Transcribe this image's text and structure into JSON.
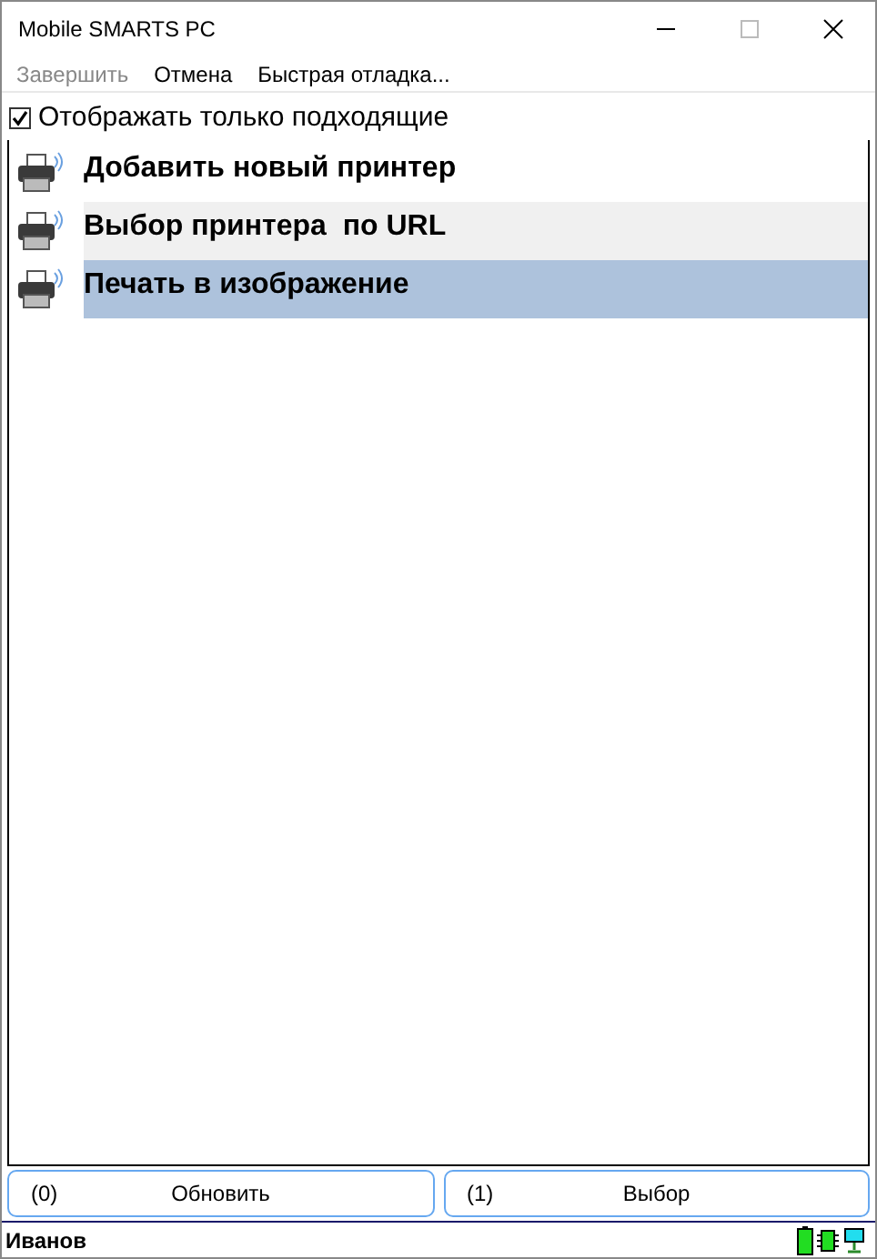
{
  "window": {
    "title": "Mobile SMARTS PC"
  },
  "menu": [
    {
      "label": "Завершить",
      "disabled": true
    },
    {
      "label": "Отмена",
      "disabled": false
    },
    {
      "label": "Быстрая отладка...",
      "disabled": false
    }
  ],
  "filter": {
    "label": "Отображать только подходящие",
    "checked": true
  },
  "items": [
    {
      "label": "Добавить новый принтер",
      "selected": false,
      "hovered": false
    },
    {
      "label": "Выбор принтера  по URL",
      "selected": false,
      "hovered": true
    },
    {
      "label": "Печать в изображение",
      "selected": true,
      "hovered": false
    }
  ],
  "buttons": [
    {
      "key": "(0)",
      "label": "Обновить"
    },
    {
      "key": "(1)",
      "label": "Выбор"
    }
  ],
  "status_bar": {
    "user": "Иванов"
  }
}
